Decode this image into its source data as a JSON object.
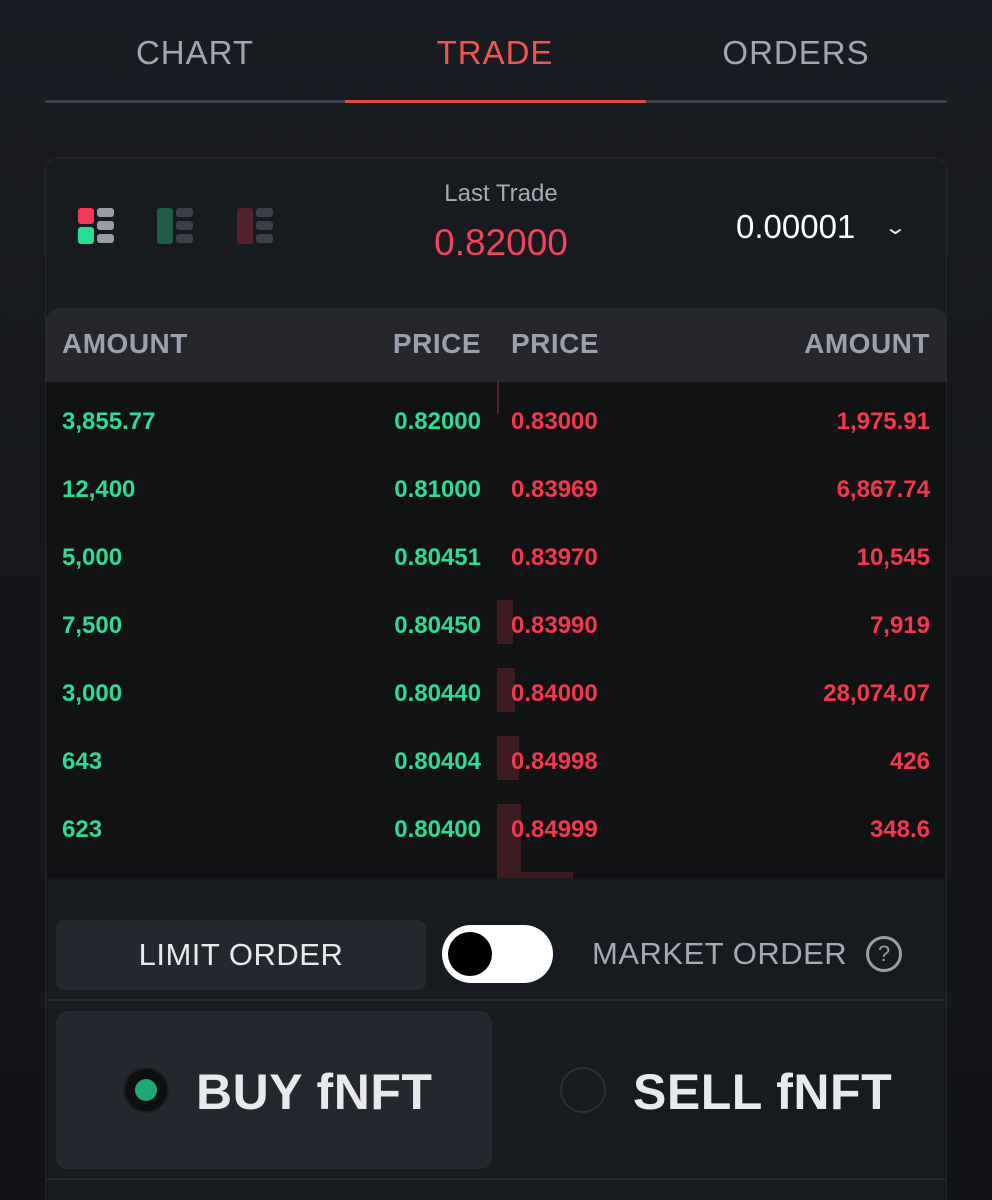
{
  "tabs": [
    {
      "label": "CHART",
      "active": false
    },
    {
      "label": "TRADE",
      "active": true
    },
    {
      "label": "ORDERS",
      "active": false
    }
  ],
  "colors": {
    "accent": "#e8473d",
    "buy": "#2bdc95",
    "sell": "#f3384e",
    "background": "#15171b"
  },
  "header": {
    "layout_icons": [
      "book-both-icon",
      "book-bids-icon",
      "book-asks-icon"
    ],
    "last_trade_label": "Last Trade",
    "last_trade_value": "0.82000",
    "precision_value": "0.00001",
    "precision_icon": "chevron-down-icon"
  },
  "order_book": {
    "headers": {
      "bid_amount": "AMOUNT",
      "bid_price": "PRICE",
      "ask_price": "PRICE",
      "ask_amount": "AMOUNT"
    },
    "rows": [
      {
        "bid_amount": "3,855.77",
        "bid_price": "0.82000",
        "ask_price": "0.83000",
        "ask_amount": "1,975.91"
      },
      {
        "bid_amount": "12,400",
        "bid_price": "0.81000",
        "ask_price": "0.83969",
        "ask_amount": "6,867.74"
      },
      {
        "bid_amount": "5,000",
        "bid_price": "0.80451",
        "ask_price": "0.83970",
        "ask_amount": "10,545"
      },
      {
        "bid_amount": "7,500",
        "bid_price": "0.80450",
        "ask_price": "0.83990",
        "ask_amount": "7,919"
      },
      {
        "bid_amount": "3,000",
        "bid_price": "0.80440",
        "ask_price": "0.84000",
        "ask_amount": "28,074.07"
      },
      {
        "bid_amount": "643",
        "bid_price": "0.80404",
        "ask_price": "0.84998",
        "ask_amount": "426"
      },
      {
        "bid_amount": "623",
        "bid_price": "0.80400",
        "ask_price": "0.84999",
        "ask_amount": "348.6"
      }
    ]
  },
  "order_type": {
    "limit_label": "LIMIT ORDER",
    "market_label": "MARKET ORDER",
    "is_market": false,
    "help_icon": "question-icon",
    "help_glyph": "?"
  },
  "side": {
    "buy_label": "BUY fNFT",
    "sell_label": "SELL fNFT",
    "selected": "buy"
  }
}
